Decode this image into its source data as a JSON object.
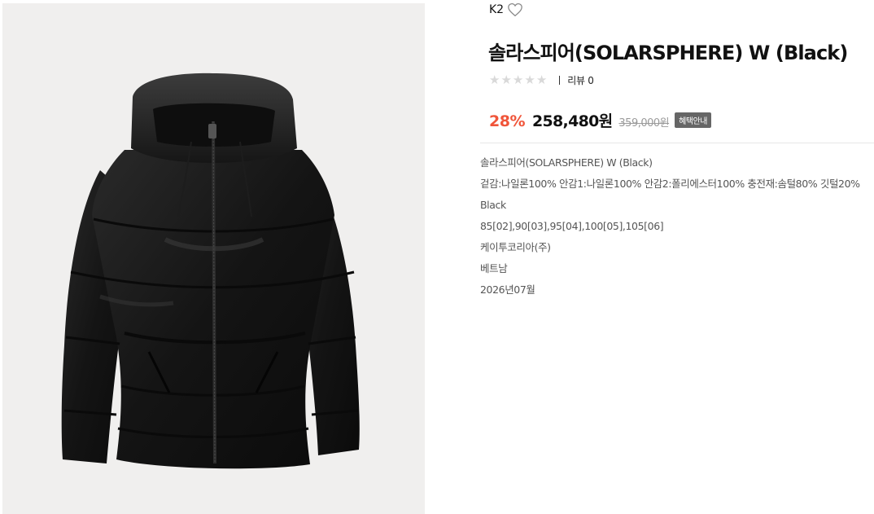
{
  "brand": {
    "name": "K2",
    "wishlist_icon": "heart-outline-icon"
  },
  "product": {
    "title": "솔라스피어(SOLARSPHERE) W (Black)",
    "image_alt": "black hooded down jacket"
  },
  "rating": {
    "stars": 0,
    "max_stars": 5,
    "review_label": "리뷰 0"
  },
  "price": {
    "discount": "28%",
    "sale_price": "258,480원",
    "original_price": "359,000원",
    "benefit_label": "혜택안내",
    "discount_color": "#f0553a"
  },
  "specs": [
    "솔라스피어(SOLARSPHERE) W (Black)",
    "겉감:나일론100% 안감1:나일론100% 안감2:폴리에스터100% 충전재:솜털80% 깃털20%",
    "Black",
    "85[02],90[03],95[04],100[05],105[06]",
    "케이투코리아(주)",
    "베트남",
    "2026년07월"
  ]
}
